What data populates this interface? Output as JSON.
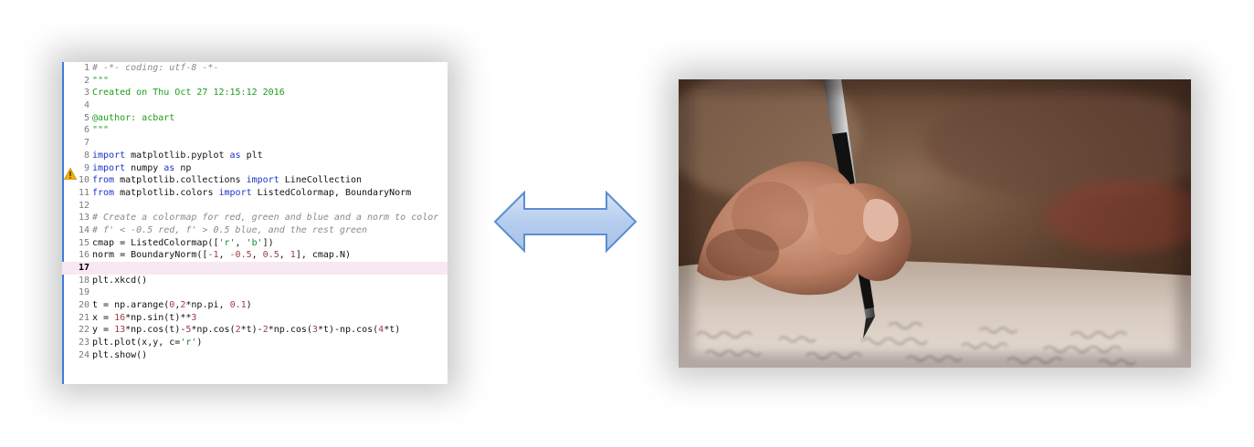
{
  "editor": {
    "lines": [
      {
        "no": "1",
        "segments": [
          {
            "t": "# -*- coding: utf-8 -*-",
            "c": "comment"
          }
        ]
      },
      {
        "no": "2",
        "segments": [
          {
            "t": "\"\"\"",
            "c": "doc"
          }
        ]
      },
      {
        "no": "3",
        "segments": [
          {
            "t": "Created on Thu Oct 27 12:15:12 2016",
            "c": "doc"
          }
        ]
      },
      {
        "no": "4",
        "segments": []
      },
      {
        "no": "5",
        "segments": [
          {
            "t": "@author: acbart",
            "c": "doc"
          }
        ]
      },
      {
        "no": "6",
        "segments": [
          {
            "t": "\"\"\"",
            "c": "doc"
          }
        ]
      },
      {
        "no": "7",
        "segments": []
      },
      {
        "no": "8",
        "segments": [
          {
            "t": "import",
            "c": "kw"
          },
          {
            "t": " matplotlib.pyplot ",
            "c": "plain"
          },
          {
            "t": "as",
            "c": "kw"
          },
          {
            "t": " plt",
            "c": "plain"
          }
        ]
      },
      {
        "no": "9",
        "segments": [
          {
            "t": "import",
            "c": "kw"
          },
          {
            "t": " numpy ",
            "c": "plain"
          },
          {
            "t": "as",
            "c": "kw"
          },
          {
            "t": " np",
            "c": "plain"
          }
        ]
      },
      {
        "no": "10",
        "segments": [
          {
            "t": "from",
            "c": "kw"
          },
          {
            "t": " matplotlib.collections ",
            "c": "plain"
          },
          {
            "t": "import",
            "c": "kw"
          },
          {
            "t": " LineCollection",
            "c": "plain"
          }
        ]
      },
      {
        "no": "11",
        "segments": [
          {
            "t": "from",
            "c": "kw"
          },
          {
            "t": " matplotlib.colors ",
            "c": "plain"
          },
          {
            "t": "import",
            "c": "kw"
          },
          {
            "t": " ListedColormap, BoundaryNorm",
            "c": "plain"
          }
        ]
      },
      {
        "no": "12",
        "segments": []
      },
      {
        "no": "13",
        "segments": [
          {
            "t": "# Create a colormap for red, green and blue and a norm to color",
            "c": "comment"
          }
        ]
      },
      {
        "no": "14",
        "segments": [
          {
            "t": "# f' < -0.5 red, f' > 0.5 blue, and the rest green",
            "c": "comment"
          }
        ]
      },
      {
        "no": "15",
        "segments": [
          {
            "t": "cmap = ListedColormap([",
            "c": "plain"
          },
          {
            "t": "'r'",
            "c": "str"
          },
          {
            "t": ", ",
            "c": "plain"
          },
          {
            "t": "'b'",
            "c": "str"
          },
          {
            "t": "])",
            "c": "plain"
          }
        ]
      },
      {
        "no": "16",
        "segments": [
          {
            "t": "norm = BoundaryNorm([",
            "c": "plain"
          },
          {
            "t": "-1",
            "c": "num"
          },
          {
            "t": ", ",
            "c": "plain"
          },
          {
            "t": "-0.5",
            "c": "num"
          },
          {
            "t": ", ",
            "c": "plain"
          },
          {
            "t": "0.5",
            "c": "num"
          },
          {
            "t": ", ",
            "c": "plain"
          },
          {
            "t": "1",
            "c": "num"
          },
          {
            "t": "], cmap.N)",
            "c": "plain"
          }
        ]
      },
      {
        "no": "17",
        "segments": [],
        "current": true
      },
      {
        "no": "18",
        "segments": [
          {
            "t": "plt.xkcd()",
            "c": "plain"
          }
        ]
      },
      {
        "no": "19",
        "segments": []
      },
      {
        "no": "20",
        "segments": [
          {
            "t": "t = np.arange(",
            "c": "plain"
          },
          {
            "t": "0",
            "c": "num"
          },
          {
            "t": ",",
            "c": "plain"
          },
          {
            "t": "2",
            "c": "num"
          },
          {
            "t": "*np.pi, ",
            "c": "plain"
          },
          {
            "t": "0.1",
            "c": "num"
          },
          {
            "t": ")",
            "c": "plain"
          }
        ]
      },
      {
        "no": "21",
        "segments": [
          {
            "t": "x = ",
            "c": "plain"
          },
          {
            "t": "16",
            "c": "num"
          },
          {
            "t": "*np.sin(t)**",
            "c": "plain"
          },
          {
            "t": "3",
            "c": "num"
          }
        ]
      },
      {
        "no": "22",
        "segments": [
          {
            "t": "y = ",
            "c": "plain"
          },
          {
            "t": "13",
            "c": "num"
          },
          {
            "t": "*np.cos(t)-",
            "c": "plain"
          },
          {
            "t": "5",
            "c": "num"
          },
          {
            "t": "*np.cos(",
            "c": "plain"
          },
          {
            "t": "2",
            "c": "num"
          },
          {
            "t": "*t)-",
            "c": "plain"
          },
          {
            "t": "2",
            "c": "num"
          },
          {
            "t": "*np.cos(",
            "c": "plain"
          },
          {
            "t": "3",
            "c": "num"
          },
          {
            "t": "*t)-np.cos(",
            "c": "plain"
          },
          {
            "t": "4",
            "c": "num"
          },
          {
            "t": "*t)",
            "c": "plain"
          }
        ]
      },
      {
        "no": "23",
        "segments": [
          {
            "t": "plt.plot(x,y, c=",
            "c": "plain"
          },
          {
            "t": "'r'",
            "c": "str"
          },
          {
            "t": ")",
            "c": "plain"
          }
        ]
      },
      {
        "no": "24",
        "segments": [
          {
            "t": "plt.show()",
            "c": "plain"
          }
        ]
      }
    ]
  },
  "icons": {
    "warning": "warning-icon",
    "arrow": "double-arrow-icon",
    "photo": "hand-writing-photo"
  },
  "colors": {
    "arrow_fill": "#bcd3ef",
    "arrow_stroke": "#5b8ed0",
    "current_line": "#f8e8f3",
    "keyword": "#1c34c8",
    "docstring": "#1c9c1c",
    "comment": "#8a8a8a",
    "number": "#a23a4a"
  }
}
